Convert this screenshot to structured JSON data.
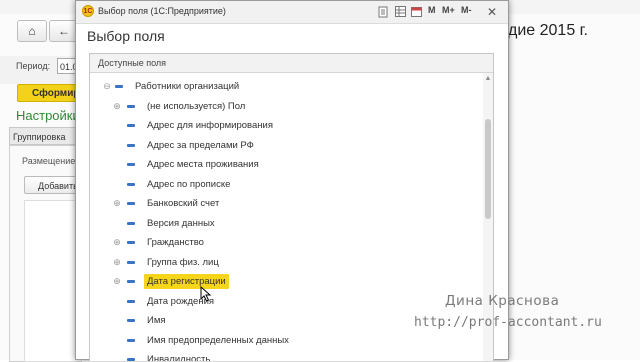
{
  "background": {
    "title_fragment": "дие 2015 г.",
    "period_label": "Период:",
    "period_value": "01.0",
    "form_button_label": "Сформир",
    "settings_label": "Настройки",
    "tab_label": "Группировка",
    "placement_label": "Размещение",
    "add_button_label": "Добавить"
  },
  "dialog": {
    "window_title": "Выбор поля  (1С:Предприятие)",
    "toolbar": {
      "m_label": "M",
      "m_plus_label": "M+",
      "m_minus_label": "M-"
    },
    "heading": "Выбор поля",
    "panel_header": "Доступные поля",
    "root_item": "Работники организаций",
    "items": [
      {
        "label": "(не используется) Пол",
        "expandable": true,
        "selected": false
      },
      {
        "label": "Адрес для информирования",
        "expandable": false,
        "selected": false
      },
      {
        "label": "Адрес за пределами РФ",
        "expandable": false,
        "selected": false
      },
      {
        "label": "Адрес места проживания",
        "expandable": false,
        "selected": false
      },
      {
        "label": "Адрес по прописке",
        "expandable": false,
        "selected": false
      },
      {
        "label": "Банковский счет",
        "expandable": true,
        "selected": false
      },
      {
        "label": "Версия данных",
        "expandable": false,
        "selected": false
      },
      {
        "label": "Гражданство",
        "expandable": true,
        "selected": false
      },
      {
        "label": "Группа физ. лиц",
        "expandable": true,
        "selected": false
      },
      {
        "label": "Дата регистрации",
        "expandable": true,
        "selected": true
      },
      {
        "label": "Дата рождения",
        "expandable": false,
        "selected": false
      },
      {
        "label": "Имя",
        "expandable": false,
        "selected": false
      },
      {
        "label": "Имя предопределенных данных",
        "expandable": false,
        "selected": false
      },
      {
        "label": "Инвалидность",
        "expandable": false,
        "selected": false
      }
    ]
  },
  "watermark": {
    "name": "Дина Краснова",
    "url": "http://prof-accontant.ru"
  },
  "colors": {
    "selection": "#f6d51b",
    "field_icon": "#3b74c6",
    "settings_green": "#2f8a36"
  }
}
